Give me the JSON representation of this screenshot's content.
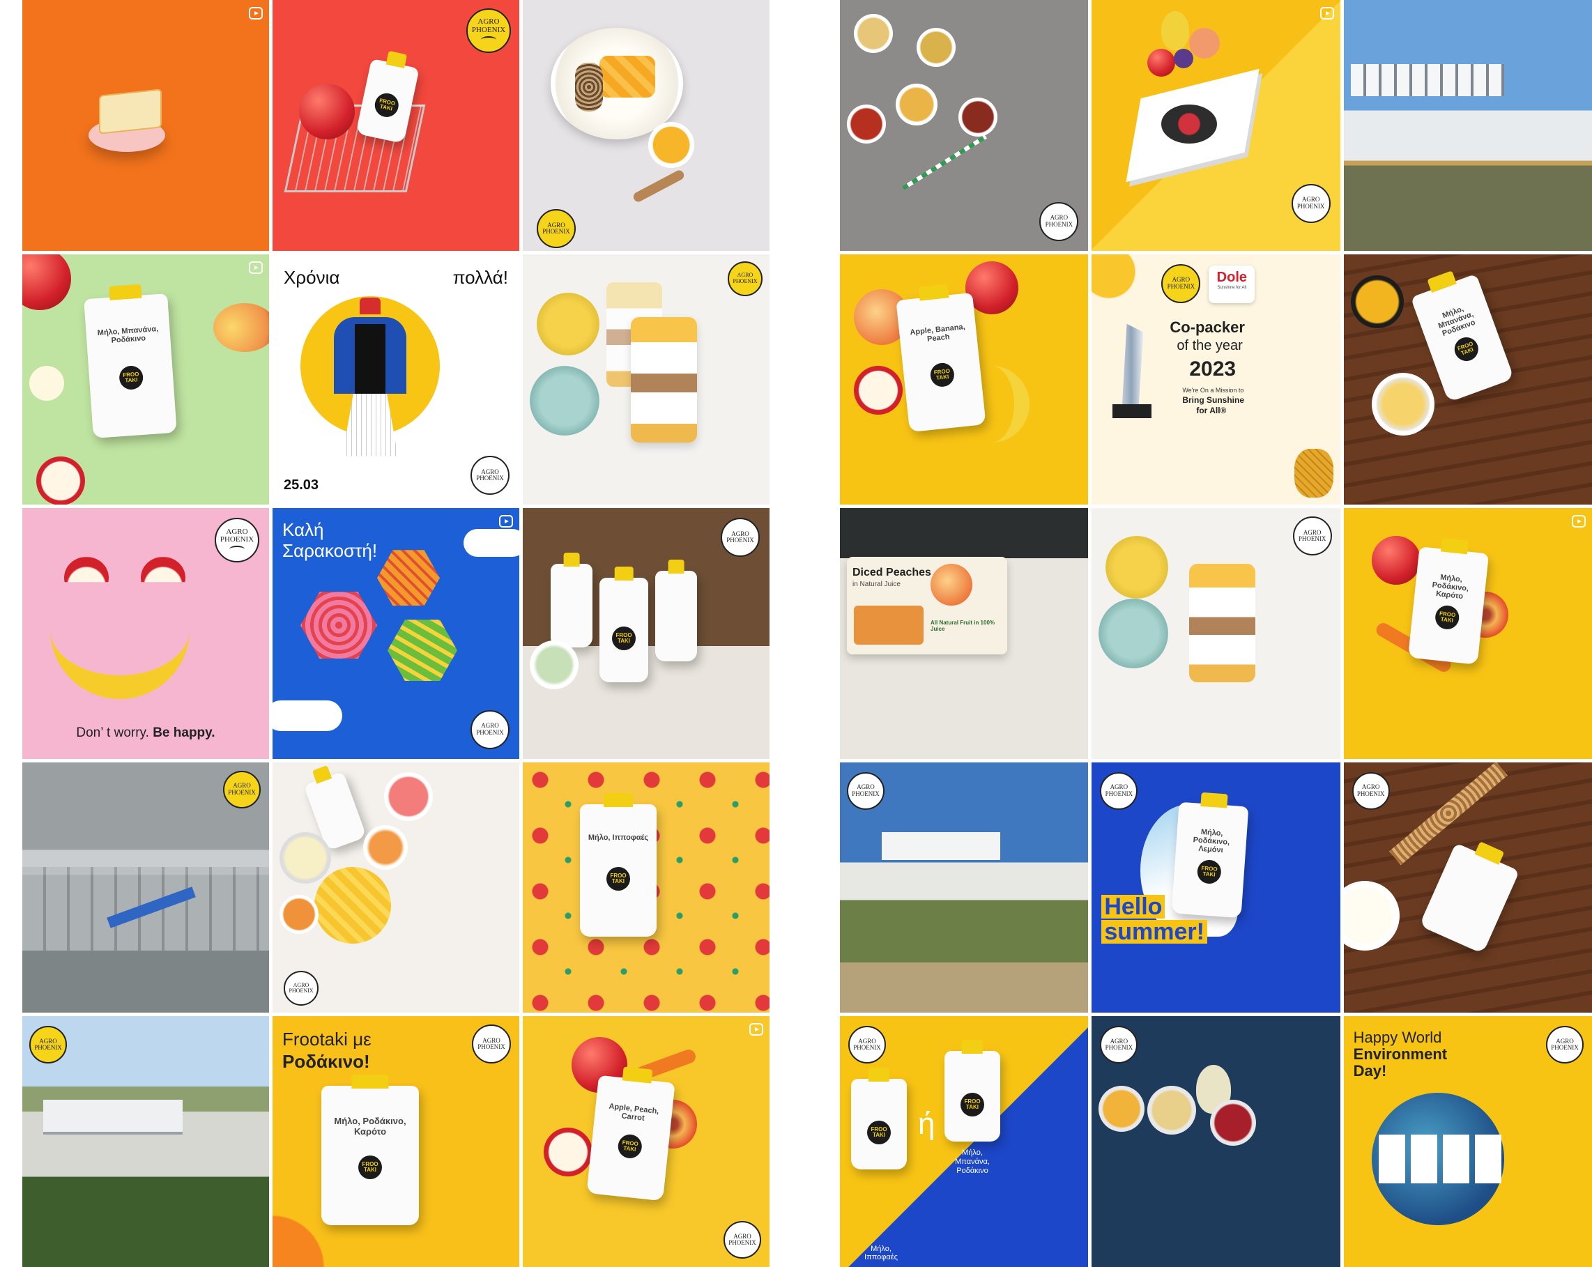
{
  "left_grid": {
    "tiles": [
      {
        "id": "orange-product-pedestal",
        "reel": true
      },
      {
        "id": "shopping-basket"
      },
      {
        "id": "yogurt-mango-bowl"
      },
      {
        "id": "green-pouch",
        "reel": true,
        "pouch_label": "Μήλο, Μπανάνα, Ροδάκινο"
      },
      {
        "id": "greek-independence",
        "greeting_left": "Χρόνια",
        "greeting_right": "πολλά!",
        "date": "25.03"
      },
      {
        "id": "parfait-jars"
      },
      {
        "id": "smile-fruit",
        "caption_regular": "Don’ t worry.",
        "caption_bold": "Be happy."
      },
      {
        "id": "kites",
        "reel": true,
        "title_line1": "Καλή",
        "title_line2": "Σαρακοστή!"
      },
      {
        "id": "product-lineup"
      },
      {
        "id": "factory-interior"
      },
      {
        "id": "fruit-cups-flatlay"
      },
      {
        "id": "apple-pattern-pouch",
        "pouch_label": "Μήλο, Ιπποφαές"
      },
      {
        "id": "aerial-factory"
      },
      {
        "id": "frootaki-peach",
        "title_line1": "Frootaki με",
        "title_line2": "Ροδάκινο!",
        "pouch_label": "Μήλο, Ροδάκινο, Καρότο"
      },
      {
        "id": "apple-peach-carrot",
        "reel": true,
        "pouch_label": "Apple, Peach, Carrot"
      }
    ]
  },
  "right_grid": {
    "tiles": [
      {
        "id": "juice-flatlay"
      },
      {
        "id": "record-player",
        "reel": true
      },
      {
        "id": "factory-building"
      },
      {
        "id": "banana-peach-pouch",
        "pouch_label": "Apple, Banana, Peach"
      },
      {
        "id": "copacker-award",
        "brand": "Dole",
        "brand_tag": "Sunshine for All",
        "heading1": "Co-packer",
        "heading2": "of the year",
        "year": "2023",
        "mission1": "We're On a Mission to",
        "mission2": "Bring Sunshine",
        "mission3": "for All®"
      },
      {
        "id": "wood-table-pouch",
        "pouch_label": "Μήλο, Μπανάνα, Ροδάκινο"
      },
      {
        "id": "diced-peaches",
        "pack_title": "Diced Peaches",
        "pack_subtitle": "in Natural Juice",
        "pack_claim": "All Natural Fruit in 100% Juice"
      },
      {
        "id": "parfait-jars-2"
      },
      {
        "id": "yellow-pouch-carrot",
        "reel": true,
        "pouch_label": "Μήλο, Ροδάκινο, Καρότο"
      },
      {
        "id": "factory-landscape"
      },
      {
        "id": "hello-summer",
        "line1": "Hello",
        "line2": "summer!",
        "pouch_label": "Μήλο, Ροδάκινο, Λεμόνι"
      },
      {
        "id": "granola-pouch"
      },
      {
        "id": "either-or",
        "or_text": "ή",
        "label_left": "Μήλο, Ιπποφαές",
        "label_right1": "Μήλο,",
        "label_right2": "Μπανάνα,",
        "label_right3": "Ροδάκινο"
      },
      {
        "id": "puree-bowls"
      },
      {
        "id": "environment-day",
        "line1": "Happy World",
        "line2": "Environment",
        "line3": "Day!"
      }
    ]
  },
  "logo": {
    "line1": "AGRO",
    "line2": "PHOENIX"
  },
  "brand_badge": "FROO TAKI"
}
